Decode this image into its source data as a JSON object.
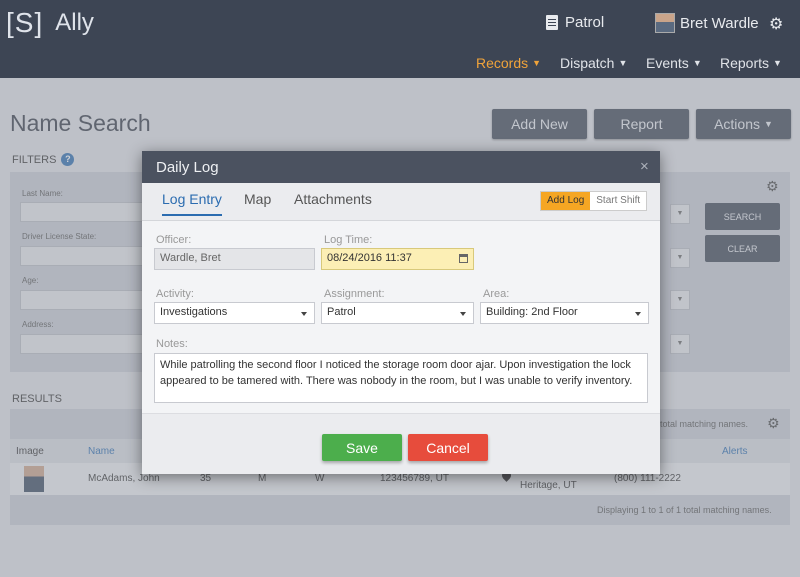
{
  "app": {
    "logo_mark": "[S]",
    "name": "Ally"
  },
  "header": {
    "context": "Patrol",
    "user_name": "Bret Wardle",
    "nav": [
      {
        "label": "Records"
      },
      {
        "label": "Dispatch"
      },
      {
        "label": "Events"
      },
      {
        "label": "Reports"
      }
    ]
  },
  "page": {
    "title": "Name Search",
    "buttons": {
      "add_new": "Add New",
      "report": "Report",
      "actions": "Actions"
    }
  },
  "filters": {
    "title": "FILTERS",
    "fields": [
      "Last Name:",
      "Driver License State:",
      "Age:",
      "Address:"
    ],
    "search": "SEARCH",
    "clear": "CLEAR"
  },
  "results": {
    "title": "RESULTS",
    "matching_top": "total matching names.",
    "columns": {
      "image": "Image",
      "name": "Name",
      "alerts": "Alerts"
    },
    "rows": [
      {
        "name": "McAdams, John",
        "age": "35",
        "sex": "M",
        "race": "W",
        "dl": "123456789, UT",
        "address": "Heritage, UT",
        "phone": "(800) 111-2222"
      }
    ],
    "footer": "Displaying 1 to 1 of 1 total matching names."
  },
  "modal": {
    "title": "Daily Log",
    "close": "×",
    "tabs": [
      "Log Entry",
      "Map",
      "Attachments"
    ],
    "toggle": {
      "add_log": "Add Log",
      "start_shift": "Start Shift"
    },
    "officer_label": "Officer:",
    "officer_value": "Wardle, Bret",
    "log_time_label": "Log Time:",
    "log_time_value": "08/24/2016 11:37",
    "activity_label": "Activity:",
    "activity_value": "Investigations",
    "assignment_label": "Assignment:",
    "assignment_value": "Patrol",
    "area_label": "Area:",
    "area_value": "Building: 2nd Floor",
    "notes_label": "Notes:",
    "notes_value": "While patrolling the second floor I noticed the storage room door ajar. Upon investigation the lock appeared to be tamered with. There was nobody in the room, but I was unable to verify inventory.",
    "save": "Save",
    "cancel": "Cancel"
  }
}
